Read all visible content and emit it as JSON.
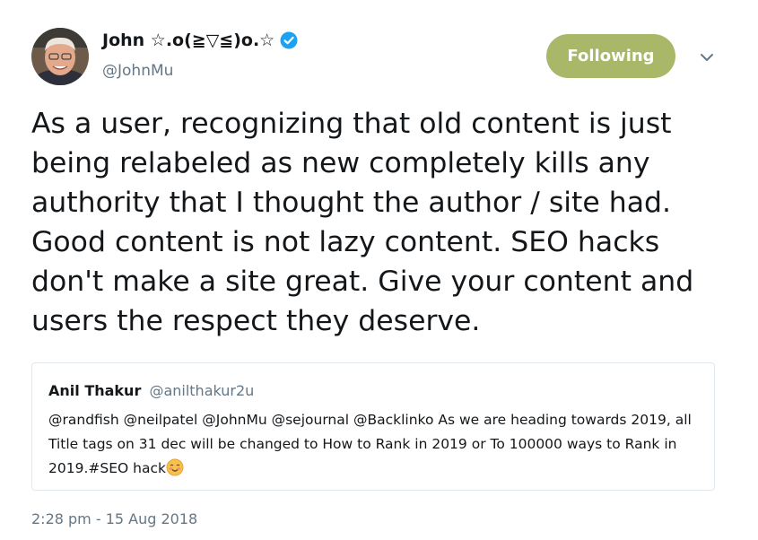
{
  "author": {
    "name": "John ☆.o(≧▽≦)o.☆",
    "handle": "@JohnMu",
    "verified": true
  },
  "follow_button": {
    "label": "Following",
    "color": "#a9b868"
  },
  "tweet": {
    "text": "As a user, recognizing that old content is just being relabeled as new completely kills any authority that I thought the author / site had. Good content is not lazy content. SEO hacks don't make a site great. Give your content and users the respect they deserve.",
    "timestamp": "2:28 pm - 15 Aug 2018"
  },
  "quoted_tweet": {
    "name": "Anil Thakur",
    "handle": "@anilthakur2u",
    "text": "@randfish @neilpatel @JohnMu @sejournal  @Backlinko  As we are heading towards 2019,  all Title tags on 31 dec will be changed to How to Rank in 2019 or To 100000 ways to Rank in 2019.#SEO hack"
  },
  "icons": {
    "verified": "verified-badge-icon",
    "chevron": "chevron-down-icon",
    "emoji": "smiling-face-emoji"
  },
  "colors": {
    "text": "#14171a",
    "secondary": "#657786",
    "verified": "#1da1f2",
    "border": "#e1e8ed"
  }
}
